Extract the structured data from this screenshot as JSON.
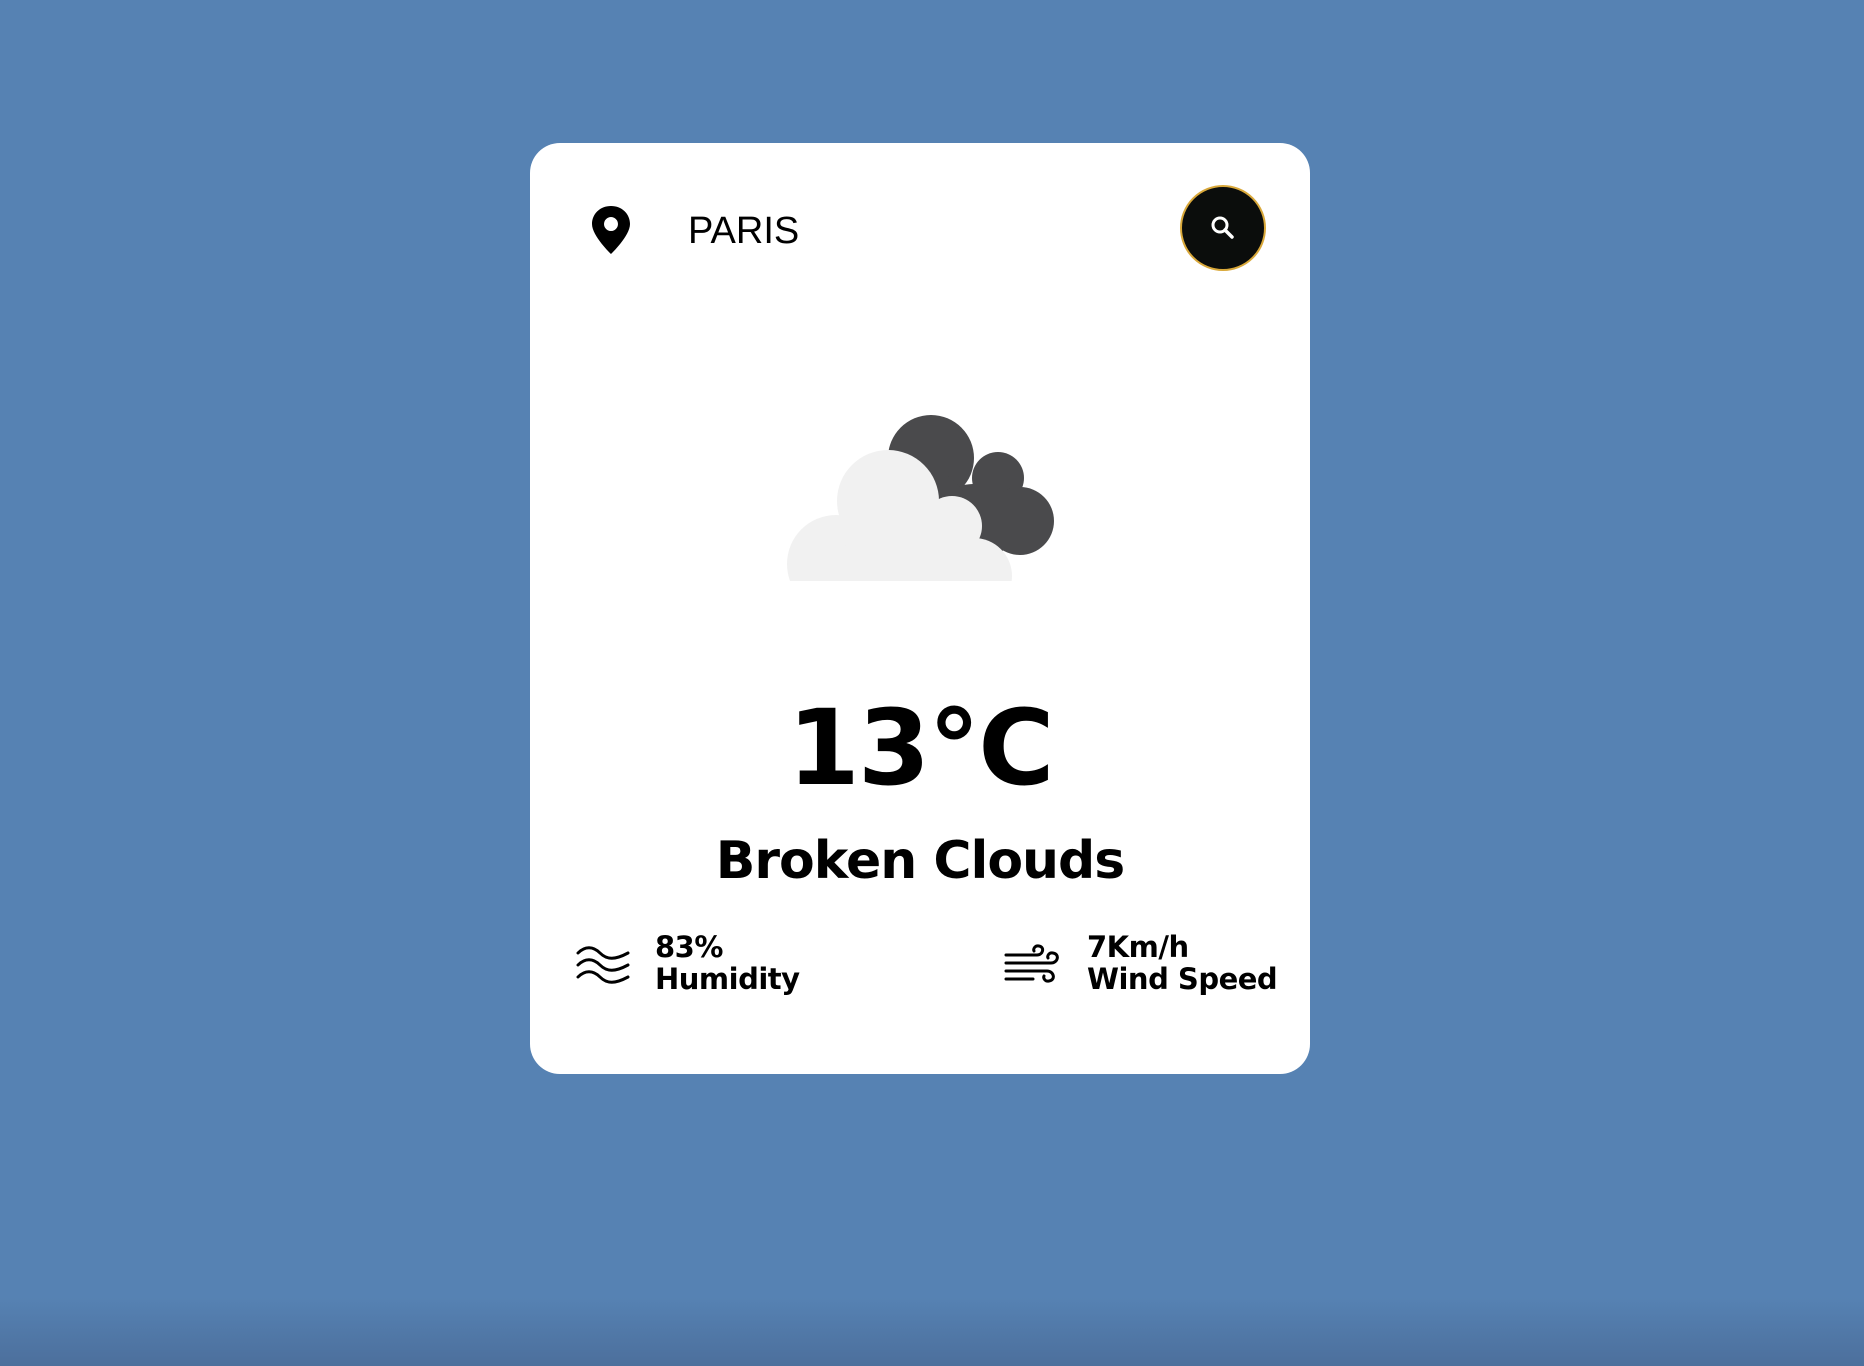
{
  "search": {
    "value": "PARIS",
    "placeholder": "",
    "button_icon": "search-icon"
  },
  "location_icon": "map-pin-icon",
  "weather": {
    "icon": "broken-clouds-icon",
    "temperature": "13°C",
    "description": "Broken Clouds"
  },
  "details": {
    "humidity": {
      "icon": "humidity-waves-icon",
      "value": "83%",
      "label": "Humidity"
    },
    "wind": {
      "icon": "wind-icon",
      "value": "7Km/h",
      "label": "Wind Speed"
    }
  },
  "colors": {
    "background": "#5682b3",
    "card": "#ffffff",
    "search_button": "#0b0d0c",
    "search_button_border": "#d9a83a",
    "cloud_front": "#f1f1f1",
    "cloud_back": "#4a4a4c"
  }
}
